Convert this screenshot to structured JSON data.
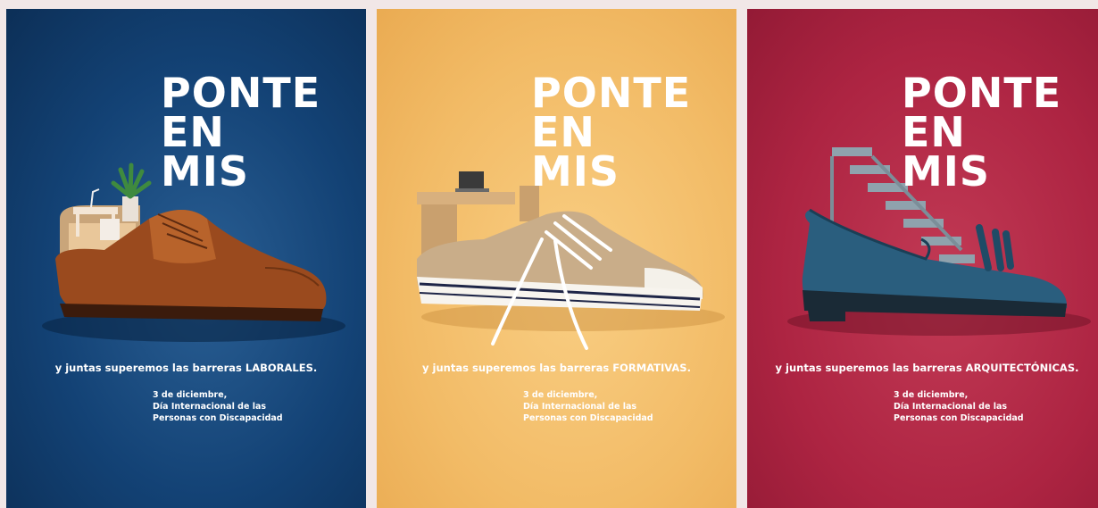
{
  "posters": [
    {
      "theme": "laborales",
      "background": "#134275",
      "headline": [
        "PONTE",
        "EN",
        "MIS"
      ],
      "tagline": "y juntas superemos las barreras LABORALES.",
      "date_lines": [
        "3 de diciembre,",
        "Día Internacional de las",
        "Personas con Discapacidad"
      ],
      "object": "brown-oxford-shoe-with-office-desk"
    },
    {
      "theme": "formativas",
      "background": "#f2bb66",
      "headline": [
        "PONTE",
        "EN",
        "MIS"
      ],
      "tagline": "y juntas superemos las barreras FORMATIVAS.",
      "date_lines": [
        "3 de diciembre,",
        "Día Internacional de las",
        "Personas con Discapacidad"
      ],
      "object": "canvas-sneaker-with-school-desk"
    },
    {
      "theme": "arquitectonicas",
      "background": "#ad2442",
      "headline": [
        "PONTE",
        "EN",
        "MIS"
      ],
      "tagline": "y juntas superemos las barreras ARQUITECTÓNICAS.",
      "date_lines": [
        "3 de diciembre,",
        "Día Internacional de las",
        "Personas con Discapacidad"
      ],
      "object": "blue-loafer-with-staircase"
    }
  ]
}
